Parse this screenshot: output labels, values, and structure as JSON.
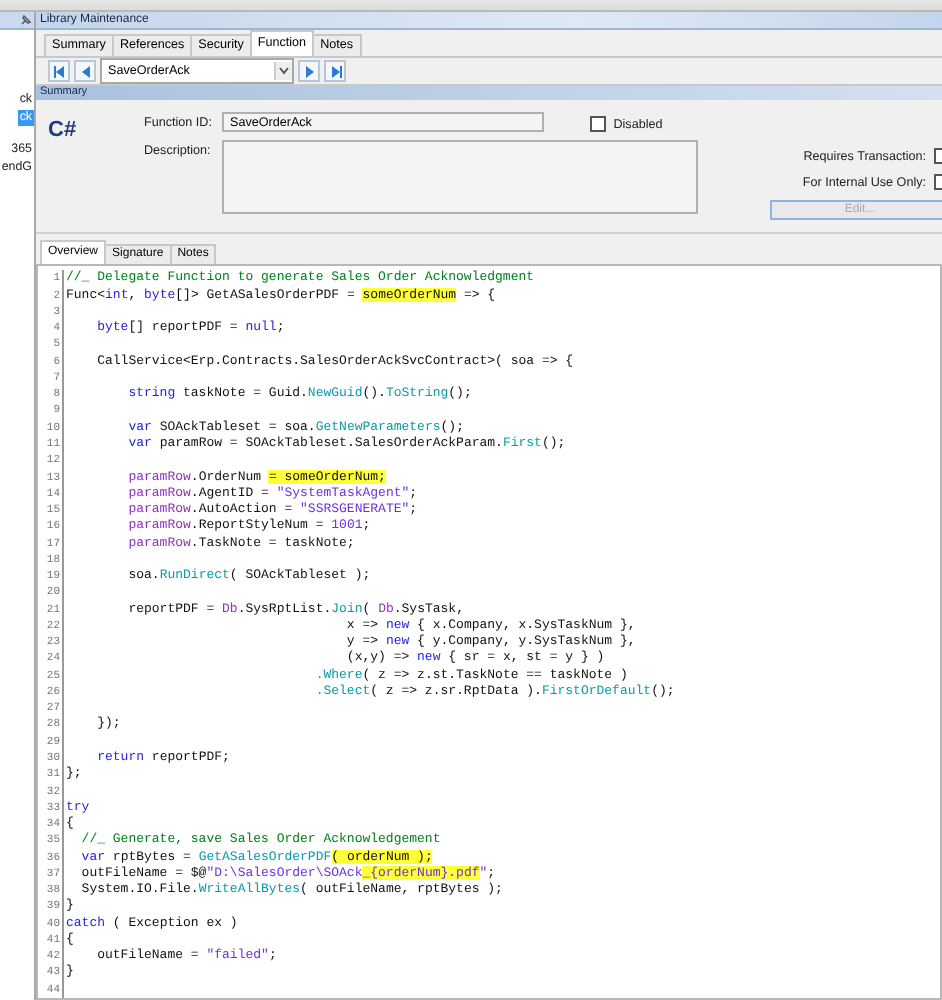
{
  "left_panel": {
    "groups": [
      {
        "items": [
          {
            "text": "ck",
            "selected": false
          },
          {
            "text": "ck",
            "selected": true
          }
        ]
      },
      {
        "items": [
          {
            "text": "365",
            "selected": false
          },
          {
            "text": "endG",
            "selected": false
          }
        ]
      }
    ]
  },
  "window": {
    "title": "Library Maintenance"
  },
  "tabs": [
    {
      "label": "Summary",
      "selected": false
    },
    {
      "label": "References",
      "selected": false
    },
    {
      "label": "Security",
      "selected": false
    },
    {
      "label": "Function",
      "selected": true
    },
    {
      "label": "Notes",
      "selected": false
    }
  ],
  "navigator": {
    "value": "SaveOrderAck"
  },
  "summary": {
    "section_title": "Summary",
    "language": "C#",
    "function_id_label": "Function ID:",
    "function_id": "SaveOrderAck",
    "disabled": {
      "label": "Disabled",
      "checked": false
    },
    "description_label": "Description:",
    "options": [
      {
        "label": "Requires Transaction:",
        "checked": false
      },
      {
        "label": "For Internal Use Only:",
        "checked": false
      }
    ],
    "edit_button": {
      "label": "Edit...",
      "disabled": true
    }
  },
  "inner_tabs": [
    {
      "label": "Overview",
      "selected": true
    },
    {
      "label": "Signature",
      "selected": false
    },
    {
      "label": "Notes",
      "selected": false
    }
  ],
  "code": [
    {
      "n": "1",
      "segs": [
        {
          "text": "//_ Delegate Function to generate Sales Order Acknowledgment",
          "kind": "comment"
        }
      ]
    },
    {
      "n": "2",
      "segs": [
        {
          "text": "Func<",
          "kind": "plain"
        },
        {
          "text": "int",
          "kind": "keyword"
        },
        {
          "text": ", ",
          "kind": "plain"
        },
        {
          "text": "byte",
          "kind": "keyword"
        },
        {
          "text": "[]> GetASalesOrderPDF = ",
          "kind": "plain"
        },
        {
          "text": "someOrderNum",
          "kind": "highlight"
        },
        {
          "text": " => {",
          "kind": "plain"
        }
      ]
    },
    {
      "n": "3"
    },
    {
      "n": "4",
      "segs": [
        {
          "text": "    byte",
          "kind": "keyword"
        },
        {
          "text": "[] reportPDF = ",
          "kind": "plain"
        },
        {
          "text": "null",
          "kind": "keyword"
        },
        {
          "text": ";",
          "kind": "plain"
        }
      ]
    },
    {
      "n": "5"
    },
    {
      "n": "6",
      "segs": [
        {
          "text": "    CallService<Erp.Contracts.SalesOrderAckSvcContract>( soa => {",
          "kind": "plain"
        }
      ]
    },
    {
      "n": "7"
    },
    {
      "n": "8",
      "segs": [
        {
          "text": "        string",
          "kind": "keyword"
        },
        {
          "text": " taskNote = Guid.",
          "kind": "plain"
        },
        {
          "text": "NewGuid",
          "kind": "method"
        },
        {
          "text": "().",
          "kind": "plain"
        },
        {
          "text": "ToString",
          "kind": "method"
        },
        {
          "text": "();",
          "kind": "plain"
        }
      ]
    },
    {
      "n": "9"
    },
    {
      "n": "10",
      "segs": [
        {
          "text": "        var",
          "kind": "keyword"
        },
        {
          "text": " SOAckTableset = soa.",
          "kind": "plain"
        },
        {
          "text": "GetNewParameters",
          "kind": "method"
        },
        {
          "text": "();",
          "kind": "plain"
        }
      ]
    },
    {
      "n": "11",
      "segs": [
        {
          "text": "        var",
          "kind": "keyword"
        },
        {
          "text": " paramRow = SOAckTableset.SalesOrderAckParam.",
          "kind": "plain"
        },
        {
          "text": "First",
          "kind": "method"
        },
        {
          "text": "();",
          "kind": "plain"
        }
      ]
    },
    {
      "n": "12"
    },
    {
      "n": "13",
      "segs": [
        {
          "text": "        paramRow",
          "kind": "variable"
        },
        {
          "text": ".OrderNum ",
          "kind": "plain"
        },
        {
          "text": "= someOrderNum;",
          "kind": "highlight"
        }
      ]
    },
    {
      "n": "14",
      "segs": [
        {
          "text": "        paramRow",
          "kind": "variable"
        },
        {
          "text": ".AgentID = ",
          "kind": "plain"
        },
        {
          "text": "\"SystemTaskAgent\"",
          "kind": "string"
        },
        {
          "text": ";",
          "kind": "plain"
        }
      ]
    },
    {
      "n": "15",
      "segs": [
        {
          "text": "        paramRow",
          "kind": "variable"
        },
        {
          "text": ".AutoAction = ",
          "kind": "plain"
        },
        {
          "text": "\"SSRSGENERATE\"",
          "kind": "string"
        },
        {
          "text": ";",
          "kind": "plain"
        }
      ]
    },
    {
      "n": "16",
      "segs": [
        {
          "text": "        paramRow",
          "kind": "variable"
        },
        {
          "text": ".ReportStyleNum = ",
          "kind": "plain"
        },
        {
          "text": "1001",
          "kind": "string"
        },
        {
          "text": ";",
          "kind": "plain"
        }
      ]
    },
    {
      "n": "17",
      "segs": [
        {
          "text": "        paramRow",
          "kind": "variable"
        },
        {
          "text": ".TaskNote = taskNote;",
          "kind": "plain"
        }
      ]
    },
    {
      "n": "18"
    },
    {
      "n": "19",
      "segs": [
        {
          "text": "        soa.",
          "kind": "plain"
        },
        {
          "text": "RunDirect",
          "kind": "method"
        },
        {
          "text": "( SOAckTableset );",
          "kind": "plain"
        }
      ]
    },
    {
      "n": "20"
    },
    {
      "n": "21",
      "segs": [
        {
          "text": "        reportPDF = ",
          "kind": "plain"
        },
        {
          "text": "Db",
          "kind": "variable"
        },
        {
          "text": ".SysRptList.",
          "kind": "plain"
        },
        {
          "text": "Join",
          "kind": "method"
        },
        {
          "text": "( ",
          "kind": "plain"
        },
        {
          "text": "Db",
          "kind": "variable"
        },
        {
          "text": ".SysTask,",
          "kind": "plain"
        }
      ]
    },
    {
      "n": "22",
      "segs": [
        {
          "text": "                                    x => ",
          "kind": "plain"
        },
        {
          "text": "new",
          "kind": "keyword"
        },
        {
          "text": " { x.Company, x.SysTaskNum },",
          "kind": "plain"
        }
      ]
    },
    {
      "n": "23",
      "segs": [
        {
          "text": "                                    y => ",
          "kind": "plain"
        },
        {
          "text": "new",
          "kind": "keyword"
        },
        {
          "text": " { y.Company, y.SysTaskNum },",
          "kind": "plain"
        }
      ]
    },
    {
      "n": "24",
      "segs": [
        {
          "text": "                                    (x,y) => ",
          "kind": "plain"
        },
        {
          "text": "new",
          "kind": "keyword"
        },
        {
          "text": " { sr = x, st = y } )",
          "kind": "plain"
        }
      ]
    },
    {
      "n": "25",
      "segs": [
        {
          "text": "                                .Where",
          "kind": "method"
        },
        {
          "text": "( z => z.st.TaskNote == taskNote )",
          "kind": "plain"
        }
      ]
    },
    {
      "n": "26",
      "segs": [
        {
          "text": "                                .Select",
          "kind": "method"
        },
        {
          "text": "( z => z.sr.RptData ).",
          "kind": "plain"
        },
        {
          "text": "FirstOrDefault",
          "kind": "method"
        },
        {
          "text": "();",
          "kind": "plain"
        }
      ]
    },
    {
      "n": "27"
    },
    {
      "n": "28",
      "segs": [
        {
          "text": "    });",
          "kind": "plain"
        }
      ]
    },
    {
      "n": "29"
    },
    {
      "n": "30",
      "segs": [
        {
          "text": "    return",
          "kind": "keyword"
        },
        {
          "text": " reportPDF;",
          "kind": "plain"
        }
      ]
    },
    {
      "n": "31",
      "segs": [
        {
          "text": "};",
          "kind": "plain"
        }
      ]
    },
    {
      "n": "32"
    },
    {
      "n": "33",
      "segs": [
        {
          "text": "try",
          "kind": "keyword"
        }
      ]
    },
    {
      "n": "34",
      "segs": [
        {
          "text": "{",
          "kind": "plain"
        }
      ]
    },
    {
      "n": "35",
      "segs": [
        {
          "text": "  //_ Generate, save Sales Order Acknowledgement",
          "kind": "comment"
        }
      ]
    },
    {
      "n": "36",
      "segs": [
        {
          "text": "  var",
          "kind": "keyword"
        },
        {
          "text": " rptBytes = ",
          "kind": "plain"
        },
        {
          "text": "GetASalesOrderPDF",
          "kind": "method"
        },
        {
          "text": "( orderNum );",
          "kind": "highlight"
        }
      ]
    },
    {
      "n": "37",
      "segs": [
        {
          "text": "  outFileName = $@",
          "kind": "plain"
        },
        {
          "text": "\"D:\\SalesOrder\\SOAck",
          "kind": "string"
        },
        {
          "text": "_{orderNum}.pdf",
          "kind": "highlight_string"
        },
        {
          "text": "\"",
          "kind": "string"
        },
        {
          "text": ";",
          "kind": "plain"
        }
      ]
    },
    {
      "n": "38",
      "segs": [
        {
          "text": "  System.IO.File.",
          "kind": "plain"
        },
        {
          "text": "WriteAllBytes",
          "kind": "method"
        },
        {
          "text": "( outFileName, rptBytes );",
          "kind": "plain"
        }
      ]
    },
    {
      "n": "39",
      "segs": [
        {
          "text": "}",
          "kind": "plain"
        }
      ]
    },
    {
      "n": "40",
      "segs": [
        {
          "text": "catch",
          "kind": "keyword"
        },
        {
          "text": " ( Exception ex )",
          "kind": "plain"
        }
      ]
    },
    {
      "n": "41",
      "segs": [
        {
          "text": "{",
          "kind": "plain"
        }
      ]
    },
    {
      "n": "42",
      "segs": [
        {
          "text": "    outFileName = ",
          "kind": "plain"
        },
        {
          "text": "\"failed\"",
          "kind": "string"
        },
        {
          "text": ";",
          "kind": "plain"
        }
      ]
    },
    {
      "n": "43",
      "segs": [
        {
          "text": "}",
          "kind": "plain"
        }
      ]
    },
    {
      "n": "44"
    }
  ]
}
